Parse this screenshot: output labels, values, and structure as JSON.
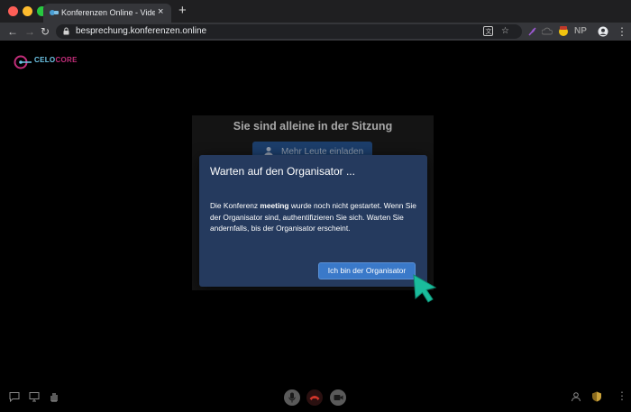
{
  "browser": {
    "tab_title": "Konferenzen Online - Video Ko",
    "tab_close": "×",
    "new_tab": "+",
    "url": "besprechung.konferenzen.online",
    "back": "←",
    "forward": "→",
    "reload": "↻",
    "ext_np": "NP",
    "menu": "⋮"
  },
  "logo": {
    "brand_a": "CELO",
    "brand_b": "CORE"
  },
  "meeting": {
    "alone_title": "Sie sind alleine in der Sitzung",
    "invite_label": "Mehr Leute einladen"
  },
  "dialog": {
    "title": "Warten auf den Organisator ...",
    "body_pre": "Die Konferenz ",
    "body_bold": "meeting",
    "body_post": " wurde noch nicht gestartet. Wenn Sie der Organisator sind, authentifizieren Sie sich. Warten Sie andernfalls, bis der Organisator erscheint.",
    "button_label": "Ich bin der Organisator"
  },
  "colors": {
    "dialog_bg": "#253a5e",
    "button_bg": "#3a79c9",
    "hangup": "#c0392b",
    "cursor": "#1abc9c"
  }
}
